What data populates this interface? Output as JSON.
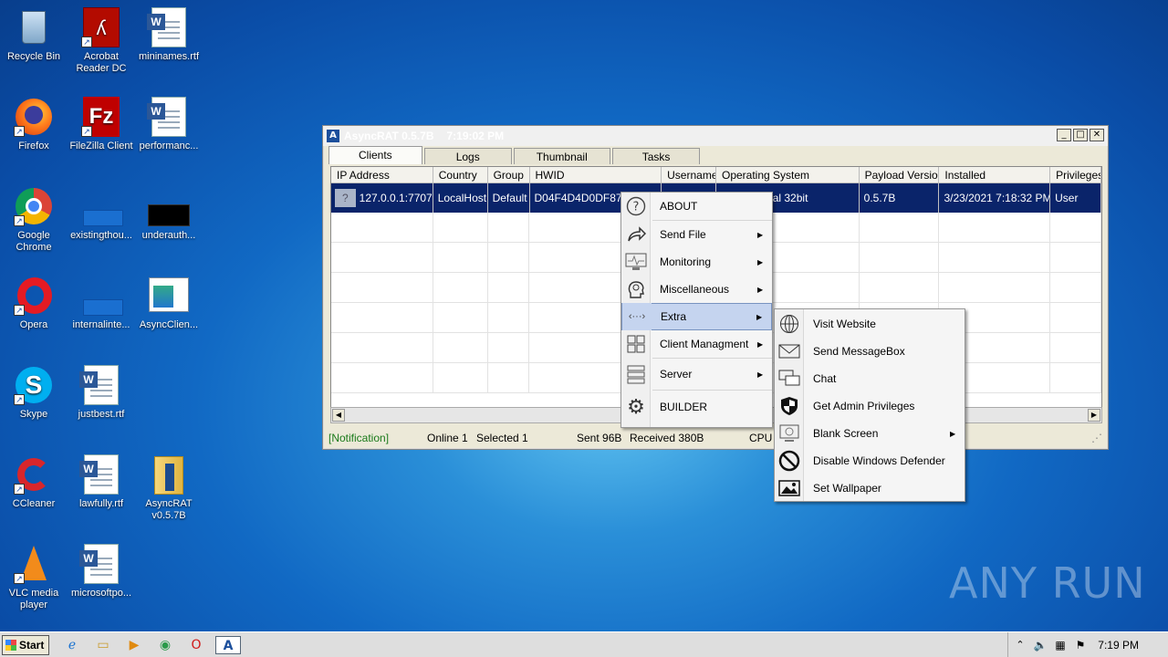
{
  "desktop": {
    "icons": [
      {
        "label": "Recycle Bin",
        "icon": "recycle-bin-icon"
      },
      {
        "label": "Acrobat\nReader DC",
        "icon": "acrobat-icon"
      },
      {
        "label": "mininames.rtf",
        "icon": "word-doc-icon"
      },
      {
        "label": "Firefox",
        "icon": "firefox-icon"
      },
      {
        "label": "FileZilla Client",
        "icon": "filezilla-icon"
      },
      {
        "label": "performanc...",
        "icon": "word-doc-icon"
      },
      {
        "label": "Google\nChrome",
        "icon": "chrome-icon"
      },
      {
        "label": "existingthou...",
        "icon": "file-icon"
      },
      {
        "label": "underauth...",
        "icon": "file-icon"
      },
      {
        "label": "Opera",
        "icon": "opera-icon"
      },
      {
        "label": "internalinte...",
        "icon": "file-icon"
      },
      {
        "label": "AsyncClien...",
        "icon": "window-file-icon"
      },
      {
        "label": "Skype",
        "icon": "skype-icon"
      },
      {
        "label": "justbest.rtf",
        "icon": "word-doc-icon"
      },
      {
        "label": "CCleaner",
        "icon": "ccleaner-icon"
      },
      {
        "label": "lawfully.rtf",
        "icon": "word-doc-icon"
      },
      {
        "label": "AsyncRAT\nv0.5.7B",
        "icon": "folder-icon"
      },
      {
        "label": "VLC media\nplayer",
        "icon": "vlc-icon"
      },
      {
        "label": "microsoftpo...",
        "icon": "word-doc-icon"
      }
    ]
  },
  "window": {
    "title": "AsyncRAT 0.5.7B",
    "time": "7:19:02 PM",
    "tabs": [
      "Clients",
      "Logs",
      "Thumbnail",
      "Tasks"
    ],
    "columns": [
      "IP Address",
      "Country",
      "Group",
      "HWID",
      "Username",
      "Operating System",
      "Payload Version",
      "Installed",
      "Privileges"
    ],
    "row": {
      "ip": "127.0.0.1:7707",
      "country": "LocalHost",
      "group": "Default",
      "hwid": "D04F4D4D0DF87B",
      "username": "",
      "os": "Professional  32bit",
      "payload": "0.5.7B",
      "installed": "3/23/2021 7:18:32 PM",
      "privileges": "User"
    },
    "status": {
      "notification": "[Notification]",
      "online": "Online 1",
      "selected": "Selected 1",
      "sent": "Sent 96B",
      "received": "Received 380B",
      "cpu": "CPU 0"
    }
  },
  "context_menu": {
    "items": [
      {
        "label": "ABOUT",
        "icon": "question-icon",
        "submenu": false
      },
      {
        "label": "Send File",
        "icon": "share-arrow-icon",
        "submenu": true
      },
      {
        "label": "Monitoring",
        "icon": "monitor-icon",
        "submenu": true
      },
      {
        "label": "Miscellaneous",
        "icon": "head-gears-icon",
        "submenu": true
      },
      {
        "label": "Extra",
        "icon": "code-dots-icon",
        "submenu": true
      },
      {
        "label": "Client Managment",
        "icon": "windows-icon",
        "submenu": true
      },
      {
        "label": "Server",
        "icon": "server-icon",
        "submenu": true
      },
      {
        "label": "BUILDER",
        "icon": "gear-icon",
        "submenu": false
      }
    ]
  },
  "submenu": {
    "items": [
      {
        "label": "Visit Website",
        "icon": "globe-icon"
      },
      {
        "label": "Send MessageBox",
        "icon": "envelope-icon"
      },
      {
        "label": "Chat",
        "icon": "chat-icon"
      },
      {
        "label": "Get Admin Privileges",
        "icon": "shield-icon"
      },
      {
        "label": "Blank Screen",
        "icon": "blank-screen-icon"
      },
      {
        "label": "Disable Windows Defender",
        "icon": "no-entry-icon"
      },
      {
        "label": "Set Wallpaper",
        "icon": "image-icon"
      }
    ]
  },
  "taskbar": {
    "start_label": "Start",
    "clock": "7:19 PM"
  },
  "watermark": "ANY RUN"
}
